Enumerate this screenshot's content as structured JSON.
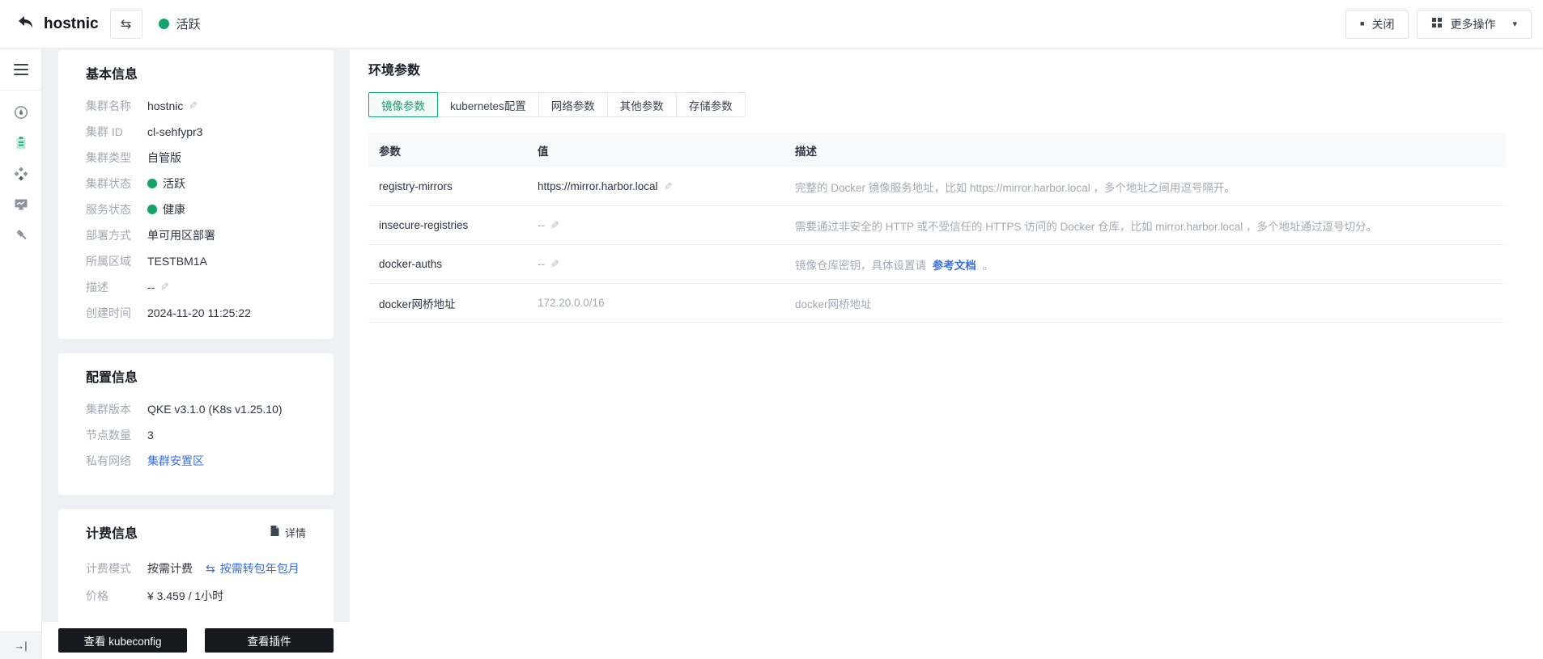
{
  "topbar": {
    "title": "hostnic",
    "status": "活跃",
    "close_label": "关闭",
    "more_label": "更多操作"
  },
  "icons": {
    "edit": "✎",
    "swap": "⇆",
    "caret": "▾",
    "square": "■",
    "collapse": "→|"
  },
  "basic_info": {
    "title": "基本信息",
    "fields": [
      {
        "label": "集群名称",
        "value": "hostnic"
      },
      {
        "label": "集群 ID",
        "value": "cl-sehfypr3"
      },
      {
        "label": "集群类型",
        "value": "自管版"
      },
      {
        "label": "集群状态",
        "value": "活跃"
      },
      {
        "label": "服务状态",
        "value": "健康"
      },
      {
        "label": "部署方式",
        "value": "单可用区部署"
      },
      {
        "label": "所属区域",
        "value": "TESTBM1A"
      },
      {
        "label": "描述",
        "value": "--"
      },
      {
        "label": "创建时间",
        "value": "2024-11-20 11:25:22"
      }
    ]
  },
  "config_info": {
    "title": "配置信息",
    "fields": [
      {
        "label": "集群版本",
        "value": "QKE v3.1.0 (K8s v1.25.10)"
      },
      {
        "label": "节点数量",
        "value": "3"
      },
      {
        "label": "私有网络",
        "value": "集群安置区"
      }
    ]
  },
  "billing_info": {
    "title": "计费信息",
    "detail_label": "详情",
    "mode_label": "计费模式",
    "mode_value": "按需计费",
    "mode_action": "按需转包年包月",
    "price_label": "价格",
    "price_value": "¥ 3.459 / 1小时"
  },
  "footer": {
    "kubeconfig_label": "查看 kubeconfig",
    "plugins_label": "查看插件"
  },
  "main": {
    "title": "环境参数",
    "tabs": [
      {
        "label": "镜像参数"
      },
      {
        "label": "kubernetes配置"
      },
      {
        "label": "网络参数"
      },
      {
        "label": "其他参数"
      },
      {
        "label": "存储参数"
      }
    ],
    "table": {
      "columns": [
        "参数",
        "值",
        "描述"
      ],
      "rows": [
        {
          "param": "registry-mirrors",
          "value": "https://mirror.harbor.local",
          "desc": "完整的 Docker 镜像服务地址，比如 https://mirror.harbor.local ，多个地址之间用逗号隔开。"
        },
        {
          "param": "insecure-registries",
          "value": "--",
          "desc": "需要通过非安全的 HTTP 或不受信任的 HTTPS 访问的 Docker 仓库，比如 mirror.harbor.local ，多个地址通过逗号切分。"
        },
        {
          "param": "docker-auths",
          "value": "--",
          "desc_prefix": "镜像仓库密钥，具体设置请",
          "desc_link": "参考文档",
          "desc_suffix": "。"
        },
        {
          "param": "docker网桥地址",
          "value": "172.20.0.0/16",
          "desc": "docker网桥地址"
        }
      ]
    }
  },
  "colors": {
    "accent_green": "#12a46a",
    "link_blue": "#3a6fe0",
    "dark_button": "#16191f"
  }
}
